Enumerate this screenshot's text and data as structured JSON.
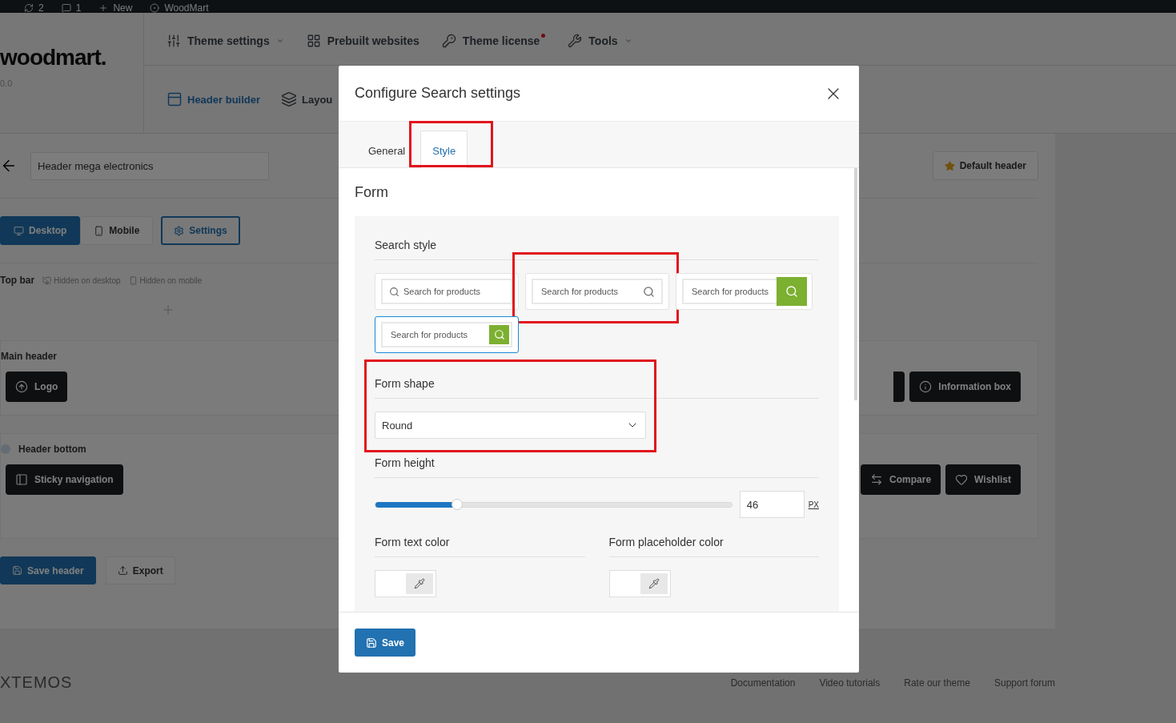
{
  "admin_bar": [
    {
      "label": "2"
    },
    {
      "label": "1"
    },
    {
      "label": "New"
    },
    {
      "label": "WoodMart"
    }
  ],
  "brand": {
    "logo": "woodmart.",
    "version": "0.0"
  },
  "top_nav": [
    {
      "label": "Theme settings",
      "dropdown": true,
      "alert": false
    },
    {
      "label": "Prebuilt websites",
      "dropdown": false,
      "alert": false
    },
    {
      "label": "Theme license",
      "dropdown": false,
      "alert": true
    },
    {
      "label": "Tools",
      "dropdown": true,
      "alert": false
    }
  ],
  "sub_nav": [
    {
      "label": "Header builder",
      "selected": true
    },
    {
      "label": "Layou",
      "selected": false
    }
  ],
  "builder": {
    "header_name": "Header mega electronics",
    "default_label": "Default header",
    "devices": [
      {
        "label": "Desktop",
        "selected": true
      },
      {
        "label": "Mobile",
        "selected": false
      }
    ],
    "settings_label": "Settings",
    "top_bar": {
      "title": "Top bar",
      "notes": [
        "Hidden on desktop",
        "Hidden on mobile"
      ]
    },
    "rows": [
      {
        "title": "Main header",
        "dot": false,
        "left": [
          {
            "kind": "element",
            "label": "Logo"
          }
        ],
        "right": [
          {
            "kind": "partial"
          },
          {
            "kind": "element",
            "label": "Information box"
          }
        ]
      },
      {
        "title": "Header bottom",
        "dot": true,
        "left": [
          {
            "kind": "element",
            "label": "Sticky navigation"
          }
        ],
        "right": [
          {
            "kind": "element",
            "label": "Compare"
          },
          {
            "kind": "element",
            "label": "Wishlist"
          }
        ]
      }
    ],
    "actions": [
      {
        "label": "Save header",
        "primary": true
      },
      {
        "label": "Export",
        "primary": false
      }
    ]
  },
  "footer": {
    "brand": "XTEMOS",
    "links": [
      "Documentation",
      "Video tutorials",
      "Rate our theme",
      "Support forum"
    ]
  },
  "modal": {
    "title": "Configure Search settings",
    "tabs": [
      {
        "label": "General",
        "selected": false,
        "highlighted": false
      },
      {
        "label": "Style",
        "selected": true,
        "highlighted": true
      }
    ],
    "section_title": "Form",
    "search_style": {
      "label": "Search style",
      "options": [
        {
          "kind": "icon-left",
          "text": "Search for products",
          "selected": false,
          "highlighted": false
        },
        {
          "kind": "icon-right",
          "text": "Search for products",
          "selected": false,
          "highlighted": true
        },
        {
          "kind": "button",
          "text": "Search for products",
          "selected": false,
          "highlighted": false
        },
        {
          "kind": "button-inset",
          "text": "Search for products",
          "selected": true,
          "highlighted": false
        }
      ]
    },
    "form_shape": {
      "label": "Form shape",
      "value": "Round",
      "highlighted": true
    },
    "form_height": {
      "label": "Form height",
      "level": 0.23,
      "value": "46",
      "unit": "PX"
    },
    "colors": [
      {
        "label": "Form text color"
      },
      {
        "label": "Form placeholder color"
      }
    ],
    "save_label": "Save"
  }
}
